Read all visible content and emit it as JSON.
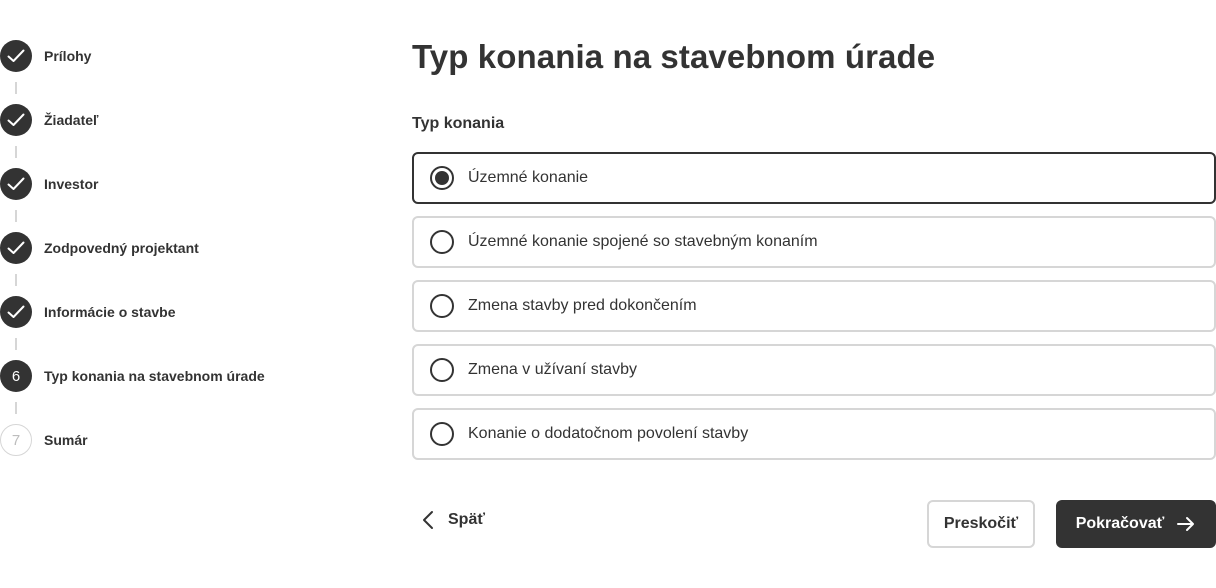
{
  "stepper": {
    "steps": [
      {
        "label": "Prílohy",
        "state": "done",
        "number": "1"
      },
      {
        "label": "Žiadateľ",
        "state": "done",
        "number": "2"
      },
      {
        "label": "Investor",
        "state": "done",
        "number": "3"
      },
      {
        "label": "Zodpovedný projektant",
        "state": "done",
        "number": "4"
      },
      {
        "label": "Informácie o stavbe",
        "state": "done",
        "number": "5"
      },
      {
        "label": "Typ konania na stavebnom úrade",
        "state": "current",
        "number": "6"
      },
      {
        "label": "Sumár",
        "state": "future",
        "number": "7"
      }
    ],
    "icons": {
      "done": "check-icon"
    }
  },
  "main": {
    "title": "Typ konania na stavebnom úrade",
    "field_label": "Typ konania",
    "options": [
      {
        "label": "Územné konanie",
        "selected": true
      },
      {
        "label": "Územné konanie spojené so stavebným konaním",
        "selected": false
      },
      {
        "label": "Zmena stavby pred dokončením",
        "selected": false
      },
      {
        "label": "Zmena v užívaní stavby",
        "selected": false
      },
      {
        "label": "Konanie o dodatočnom povolení stavby",
        "selected": false
      }
    ]
  },
  "actions": {
    "back_label": "Späť",
    "back_icon": "chevron-left-icon",
    "skip_label": "Preskočiť",
    "continue_label": "Pokračovať",
    "continue_icon": "arrow-right-icon"
  },
  "colors": {
    "primary": "#333333",
    "border": "#d6d6d6",
    "background": "#ffffff"
  }
}
